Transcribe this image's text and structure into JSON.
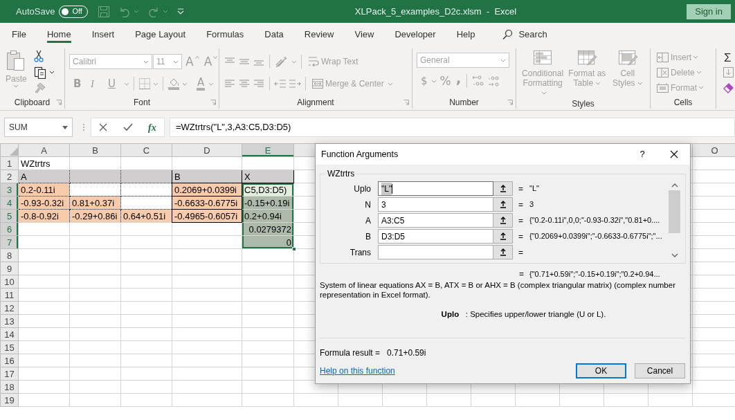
{
  "title_bar": {
    "autosave_label": "AutoSave",
    "autosave": {
      "label": "Off",
      "on": false
    },
    "title": "XLPack_5_examples_D2c.xlsm  -  Excel",
    "sign_in": "Sign in"
  },
  "tabs": [
    {
      "label": "File",
      "selected": false
    },
    {
      "label": "Home",
      "selected": true
    },
    {
      "label": "Insert",
      "selected": false
    },
    {
      "label": "Page Layout",
      "selected": false
    },
    {
      "label": "Formulas",
      "selected": false
    },
    {
      "label": "Data",
      "selected": false
    },
    {
      "label": "Review",
      "selected": false
    },
    {
      "label": "View",
      "selected": false
    },
    {
      "label": "Developer",
      "selected": false
    },
    {
      "label": "Help",
      "selected": false
    }
  ],
  "search": {
    "placeholder": "Search"
  },
  "ribbon": {
    "disabled": true,
    "clipboard": {
      "label": "Clipboard",
      "paste": "Paste"
    },
    "font": {
      "label": "Font",
      "font_name": "Calibri",
      "font_size": "11",
      "grow": "A",
      "shrink": "A",
      "bold": "B",
      "italic": "I",
      "underline": "U",
      "font_color": "A"
    },
    "alignment": {
      "label": "Alignment",
      "wrap_text": "Wrap Text",
      "merge": "Merge & Center"
    },
    "number": {
      "label": "Number",
      "format": "General",
      "currency": "$",
      "percent": "%",
      "comma": ","
    },
    "styles": {
      "label": "Styles",
      "buttons": [
        "Conditional Formatting",
        "Format as Table",
        "Cell Styles"
      ]
    },
    "cells": {
      "label": "Cells",
      "buttons": [
        "Insert",
        "Delete",
        "Format"
      ]
    },
    "editing": {
      "autosum": "Σ"
    }
  },
  "formula_bar": {
    "name_box": "SUM",
    "fx": "fx",
    "formula": "=WZtrtrs(\"L\",3,A3:C5,D3:D5)"
  },
  "sheet": {
    "columns": [
      {
        "letter": "A",
        "selected": false
      },
      {
        "letter": "B",
        "selected": false
      },
      {
        "letter": "C",
        "selected": false
      },
      {
        "letter": "D",
        "selected": false
      },
      {
        "letter": "E",
        "selected": true
      },
      {
        "letter": "O",
        "selected": false
      }
    ],
    "rows": [
      {
        "number": "1",
        "selected": false,
        "cells": [
          {
            "kind": "plain",
            "text": "WZtrtrs",
            "selected": false
          },
          {
            "kind": "plain",
            "selected": false
          },
          {
            "kind": "plain",
            "selected": false
          },
          {
            "kind": "plain",
            "selected": false
          },
          {
            "kind": "plain",
            "selected": false
          }
        ]
      },
      {
        "number": "2",
        "selected": false,
        "cells": [
          {
            "kind": "dotted",
            "text": "A",
            "color": "#d0cece",
            "selected": false
          },
          {
            "kind": "dotted",
            "color": "#d0cece",
            "selected": false
          },
          {
            "kind": "dotted",
            "color": "#d0cece",
            "selected": false
          },
          {
            "kind": "framed",
            "text": "B",
            "color": "#d0cece",
            "selected": false
          },
          {
            "kind": "framed",
            "text": "X",
            "color": "#d0cece",
            "selected": false
          }
        ]
      },
      {
        "number": "3",
        "selected": true,
        "cells": [
          {
            "kind": "dotted",
            "text": "0.2-0.11i",
            "color": "#f8cbad",
            "selected": false
          },
          {
            "kind": "dotted",
            "selected": false
          },
          {
            "kind": "dotted",
            "selected": false
          },
          {
            "kind": "framed",
            "text": "0.2069+0.0399i",
            "color": "#f8cbad",
            "selected": false
          },
          {
            "kind": "plain",
            "text": "C5,D3:D5)",
            "color": "#e4eedf",
            "selected": true
          }
        ]
      },
      {
        "number": "4",
        "selected": true,
        "cells": [
          {
            "kind": "dotted",
            "text": "-0.93-0.32i",
            "color": "#f8cbad",
            "selected": false
          },
          {
            "kind": "dotted",
            "text": "0.81+0.37i",
            "color": "#f8cbad",
            "selected": false
          },
          {
            "kind": "dotted",
            "selected": false
          },
          {
            "kind": "framed",
            "text": "-0.6633-0.6775i",
            "color": "#f8cbad",
            "selected": false
          },
          {
            "kind": "plain",
            "text": "-0.15+0.19i",
            "color": "#adb9a9",
            "selected": true
          }
        ]
      },
      {
        "number": "5",
        "selected": true,
        "cells": [
          {
            "kind": "dotted",
            "text": "-0.8-0.92i",
            "color": "#f8cbad",
            "selected": false
          },
          {
            "kind": "dotted",
            "text": "-0.29+0.86i",
            "color": "#f8cbad",
            "selected": false
          },
          {
            "kind": "dotted",
            "text": "0.64+0.51i",
            "color": "#f8cbad",
            "selected": false
          },
          {
            "kind": "framed",
            "text": "-0.4965-0.6057i",
            "color": "#f8cbad",
            "selected": false
          },
          {
            "kind": "plain",
            "text": "0.2+0.94i",
            "color": "#adb9a9",
            "selected": true
          }
        ]
      },
      {
        "number": "6",
        "selected": true,
        "cells": [
          {
            "kind": "plain",
            "selected": false
          },
          {
            "kind": "plain",
            "selected": false
          },
          {
            "kind": "plain",
            "selected": false
          },
          {
            "kind": "plain",
            "selected": false
          },
          {
            "kind": "number",
            "text": "0.0279372",
            "color": "#adb9a9",
            "selected": true
          }
        ]
      },
      {
        "number": "7",
        "selected": true,
        "cells": [
          {
            "kind": "plain",
            "selected": false
          },
          {
            "kind": "plain",
            "selected": false
          },
          {
            "kind": "plain",
            "selected": false
          },
          {
            "kind": "plain",
            "selected": false
          },
          {
            "kind": "number",
            "text": "0",
            "color": "#adb9a9",
            "selected": true
          }
        ]
      },
      {
        "number": "8",
        "selected": false
      },
      {
        "number": "9",
        "selected": false
      },
      {
        "number": "10",
        "selected": false
      },
      {
        "number": "11",
        "selected": false
      },
      {
        "number": "12",
        "selected": false
      },
      {
        "number": "13",
        "selected": false
      },
      {
        "number": "14",
        "selected": false
      },
      {
        "number": "15",
        "selected": false
      },
      {
        "number": "16",
        "selected": false
      },
      {
        "number": "17",
        "selected": false
      },
      {
        "number": "18",
        "selected": false
      },
      {
        "number": "19",
        "selected": false
      }
    ]
  },
  "dialog": {
    "title": "Function Arguments",
    "help_glyph": "?",
    "function": "WZtrtrs",
    "arguments": [
      {
        "label": "Uplo",
        "value": "\"L\"",
        "focused": true,
        "equals": "=",
        "result": "\"L\""
      },
      {
        "label": "N",
        "value": "3",
        "focused": false,
        "equals": "=",
        "result": "3"
      },
      {
        "label": "A",
        "value": "A3:C5",
        "focused": false,
        "equals": "=",
        "result": "{\"0.2-0.11i\",0,0;\"-0.93-0.32i\",\"0.81+0...."
      },
      {
        "label": "B",
        "value": "D3:D5",
        "focused": false,
        "equals": "=",
        "result": "{\"0.2069+0.0399i\";\"-0.6633-0.6775i\";\"..."
      },
      {
        "label": "Trans",
        "focused": false,
        "equals": "="
      }
    ],
    "overall": {
      "equals": "=",
      "text": "{\"0.71+0.59i\";\"-0.15+0.19i\";\"0.2+0.94..."
    },
    "description": "System of linear equations AX = B, ATX = B or AHX = B (complex triangular matrix) (complex number representation in Excel format).",
    "argument_help": "**Uplo**   : Specifies upper/lower triangle (U or L).",
    "formula_result_label": "Formula result =",
    "formula_result": "0.71+0.59i",
    "help_link": "Help on this function",
    "buttons": [
      {
        "label": "OK",
        "default": true
      },
      {
        "label": "Cancel",
        "default": false
      }
    ]
  }
}
